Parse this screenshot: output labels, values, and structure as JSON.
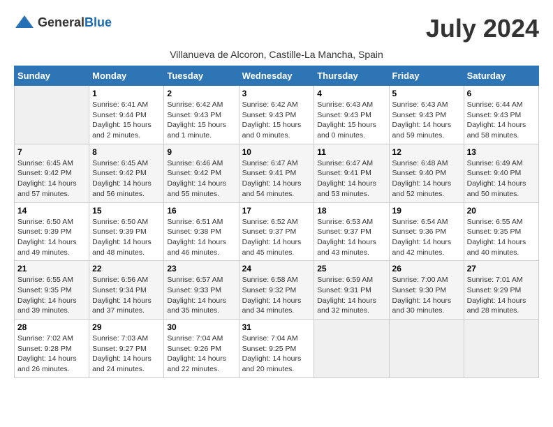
{
  "header": {
    "logo_general": "General",
    "logo_blue": "Blue",
    "month_title": "July 2024",
    "subtitle": "Villanueva de Alcoron, Castille-La Mancha, Spain"
  },
  "days_of_week": [
    "Sunday",
    "Monday",
    "Tuesday",
    "Wednesday",
    "Thursday",
    "Friday",
    "Saturday"
  ],
  "weeks": [
    [
      {
        "day": "",
        "info": ""
      },
      {
        "day": "1",
        "info": "Sunrise: 6:41 AM\nSunset: 9:44 PM\nDaylight: 15 hours\nand 2 minutes."
      },
      {
        "day": "2",
        "info": "Sunrise: 6:42 AM\nSunset: 9:43 PM\nDaylight: 15 hours\nand 1 minute."
      },
      {
        "day": "3",
        "info": "Sunrise: 6:42 AM\nSunset: 9:43 PM\nDaylight: 15 hours\nand 0 minutes."
      },
      {
        "day": "4",
        "info": "Sunrise: 6:43 AM\nSunset: 9:43 PM\nDaylight: 15 hours\nand 0 minutes."
      },
      {
        "day": "5",
        "info": "Sunrise: 6:43 AM\nSunset: 9:43 PM\nDaylight: 14 hours\nand 59 minutes."
      },
      {
        "day": "6",
        "info": "Sunrise: 6:44 AM\nSunset: 9:43 PM\nDaylight: 14 hours\nand 58 minutes."
      }
    ],
    [
      {
        "day": "7",
        "info": "Sunrise: 6:45 AM\nSunset: 9:42 PM\nDaylight: 14 hours\nand 57 minutes."
      },
      {
        "day": "8",
        "info": "Sunrise: 6:45 AM\nSunset: 9:42 PM\nDaylight: 14 hours\nand 56 minutes."
      },
      {
        "day": "9",
        "info": "Sunrise: 6:46 AM\nSunset: 9:42 PM\nDaylight: 14 hours\nand 55 minutes."
      },
      {
        "day": "10",
        "info": "Sunrise: 6:47 AM\nSunset: 9:41 PM\nDaylight: 14 hours\nand 54 minutes."
      },
      {
        "day": "11",
        "info": "Sunrise: 6:47 AM\nSunset: 9:41 PM\nDaylight: 14 hours\nand 53 minutes."
      },
      {
        "day": "12",
        "info": "Sunrise: 6:48 AM\nSunset: 9:40 PM\nDaylight: 14 hours\nand 52 minutes."
      },
      {
        "day": "13",
        "info": "Sunrise: 6:49 AM\nSunset: 9:40 PM\nDaylight: 14 hours\nand 50 minutes."
      }
    ],
    [
      {
        "day": "14",
        "info": "Sunrise: 6:50 AM\nSunset: 9:39 PM\nDaylight: 14 hours\nand 49 minutes."
      },
      {
        "day": "15",
        "info": "Sunrise: 6:50 AM\nSunset: 9:39 PM\nDaylight: 14 hours\nand 48 minutes."
      },
      {
        "day": "16",
        "info": "Sunrise: 6:51 AM\nSunset: 9:38 PM\nDaylight: 14 hours\nand 46 minutes."
      },
      {
        "day": "17",
        "info": "Sunrise: 6:52 AM\nSunset: 9:37 PM\nDaylight: 14 hours\nand 45 minutes."
      },
      {
        "day": "18",
        "info": "Sunrise: 6:53 AM\nSunset: 9:37 PM\nDaylight: 14 hours\nand 43 minutes."
      },
      {
        "day": "19",
        "info": "Sunrise: 6:54 AM\nSunset: 9:36 PM\nDaylight: 14 hours\nand 42 minutes."
      },
      {
        "day": "20",
        "info": "Sunrise: 6:55 AM\nSunset: 9:35 PM\nDaylight: 14 hours\nand 40 minutes."
      }
    ],
    [
      {
        "day": "21",
        "info": "Sunrise: 6:55 AM\nSunset: 9:35 PM\nDaylight: 14 hours\nand 39 minutes."
      },
      {
        "day": "22",
        "info": "Sunrise: 6:56 AM\nSunset: 9:34 PM\nDaylight: 14 hours\nand 37 minutes."
      },
      {
        "day": "23",
        "info": "Sunrise: 6:57 AM\nSunset: 9:33 PM\nDaylight: 14 hours\nand 35 minutes."
      },
      {
        "day": "24",
        "info": "Sunrise: 6:58 AM\nSunset: 9:32 PM\nDaylight: 14 hours\nand 34 minutes."
      },
      {
        "day": "25",
        "info": "Sunrise: 6:59 AM\nSunset: 9:31 PM\nDaylight: 14 hours\nand 32 minutes."
      },
      {
        "day": "26",
        "info": "Sunrise: 7:00 AM\nSunset: 9:30 PM\nDaylight: 14 hours\nand 30 minutes."
      },
      {
        "day": "27",
        "info": "Sunrise: 7:01 AM\nSunset: 9:29 PM\nDaylight: 14 hours\nand 28 minutes."
      }
    ],
    [
      {
        "day": "28",
        "info": "Sunrise: 7:02 AM\nSunset: 9:28 PM\nDaylight: 14 hours\nand 26 minutes."
      },
      {
        "day": "29",
        "info": "Sunrise: 7:03 AM\nSunset: 9:27 PM\nDaylight: 14 hours\nand 24 minutes."
      },
      {
        "day": "30",
        "info": "Sunrise: 7:04 AM\nSunset: 9:26 PM\nDaylight: 14 hours\nand 22 minutes."
      },
      {
        "day": "31",
        "info": "Sunrise: 7:04 AM\nSunset: 9:25 PM\nDaylight: 14 hours\nand 20 minutes."
      },
      {
        "day": "",
        "info": ""
      },
      {
        "day": "",
        "info": ""
      },
      {
        "day": "",
        "info": ""
      }
    ]
  ]
}
